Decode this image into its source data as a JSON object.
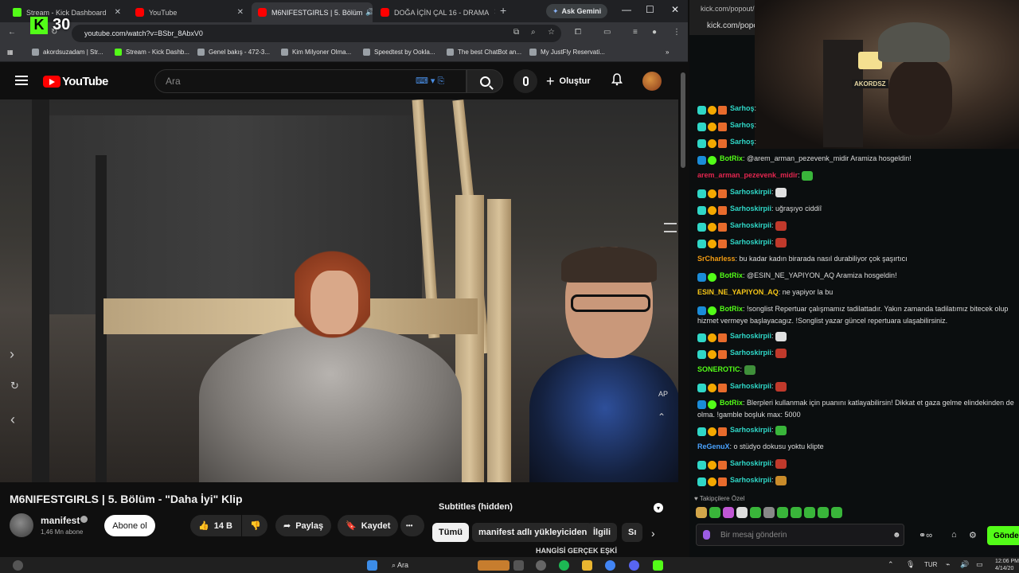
{
  "browser": {
    "tabs": [
      {
        "label": "Stream - Kick Dashboard",
        "favicon": "kick"
      },
      {
        "label": "YouTube",
        "favicon": "youtube"
      },
      {
        "label": "M6NIFESTGIRLS | 5. Bölüm",
        "favicon": "youtube",
        "active": true
      },
      {
        "label": "DOĞA İÇİN ÇAL 16 - DRAMA",
        "favicon": "youtube"
      }
    ],
    "new_tab": "+",
    "gemini_label": "Ask Gemini",
    "window_controls": [
      "—",
      "☐",
      "✕"
    ],
    "url": "youtube.com/watch?v=BSbr_8AbxV0",
    "bookmarks": [
      {
        "label": "akordsuzadam | Str...",
        "favicon": "generic"
      },
      {
        "label": "Stream - Kick Dashb...",
        "favicon": "kick"
      },
      {
        "label": "Genel bakış - 472-3...",
        "favicon": "generic"
      },
      {
        "label": "Kim Milyoner Olma...",
        "favicon": "generic"
      },
      {
        "label": "Speedtest by Ookla...",
        "favicon": "generic"
      },
      {
        "label": "The best ChatBot an...",
        "favicon": "generic"
      },
      {
        "label": "My JustFly Reservati...",
        "favicon": "generic"
      }
    ]
  },
  "kick_overlay": {
    "count": "30"
  },
  "youtube": {
    "logo_text": "YouTube",
    "search_placeholder": "Ara",
    "create_label": "Oluştur",
    "video_overlay_label": "AP",
    "video": {
      "title": "M6NIFESTGIRLS | 5. Bölüm - \"Daha İyi\" Klip",
      "channel": "manifest",
      "subscribers": "1,46 Mn abone",
      "subscribe_label": "Abone ol",
      "likes": "14 B",
      "share_label": "Paylaş",
      "save_label": "Kaydet",
      "more_label": "•••"
    },
    "side": {
      "subtitles_label": "Subtitles (hidden)",
      "chips": [
        "Tümü",
        "manifest adlı yükleyiciden",
        "İlgili",
        "Sı"
      ],
      "next_video_title": "HANGİSİ GERÇEK EŞKİ"
    }
  },
  "chat": {
    "popout_url_top": "kick.com/popout/",
    "popout_url": "kick.com/popo",
    "cam_sign": "AKORDSZ",
    "messages": [
      {
        "user": "Sarhoş",
        "badges": [
          "gift",
          "coin",
          "crown"
        ],
        "user_color": "#2fd7c7",
        "text": ""
      },
      {
        "user": "Sarhoş",
        "badges": [
          "gift",
          "coin",
          "crown"
        ],
        "user_color": "#2fd7c7",
        "text": ""
      },
      {
        "user": "Sarhoş",
        "badges": [
          "gift",
          "coin",
          "crown"
        ],
        "user_color": "#2fd7c7",
        "text": ""
      },
      {
        "user": "BotRix",
        "badges": [
          "bot",
          "verif"
        ],
        "user_color": "#53fc18",
        "text": "@arem_arman_pezevenk_midir Aramiza hosgeldin!"
      },
      {
        "user": "arem_arman_pezevenk_midir",
        "badges": [],
        "user_color": "#e3264f",
        "text": "",
        "emote": "#39b53a"
      },
      {
        "user": "Sarhoskirpii",
        "badges": [
          "gift",
          "coin",
          "crown"
        ],
        "user_color": "#2fd7c7",
        "text": "",
        "emote": "#e0e0e0"
      },
      {
        "user": "Sarhoskirpii",
        "badges": [
          "gift",
          "coin",
          "crown"
        ],
        "user_color": "#2fd7c7",
        "text": "uğraşıyo ciddiî"
      },
      {
        "user": "Sarhoskirpii",
        "badges": [
          "gift",
          "coin",
          "crown"
        ],
        "user_color": "#2fd7c7",
        "text": "",
        "emote": "#c0392b"
      },
      {
        "user": "Sarhoskirpii",
        "badges": [
          "gift",
          "coin",
          "crown"
        ],
        "user_color": "#2fd7c7",
        "text": "",
        "emote": "#c0392b"
      },
      {
        "user": "SrCharless",
        "badges": [],
        "user_color": "#f39c12",
        "text": "bu kadar kadın birarada nasıl durabiliyor çok şaşırtıcı"
      },
      {
        "user": "BotRix",
        "badges": [
          "bot",
          "verif"
        ],
        "user_color": "#53fc18",
        "text": "@ESIN_NE_YAPIYON_AQ Aramiza hosgeldin!"
      },
      {
        "user": "ESIN_NE_YAPIYON_AQ",
        "badges": [],
        "user_color": "#f5c518",
        "text": "ne yapiyor la bu"
      },
      {
        "user": "BotRix",
        "badges": [
          "bot",
          "verif"
        ],
        "user_color": "#53fc18",
        "text": "!songlist Repertuar çalışmamız tadilattadır. Yakın zamanda tadilatımız bitecek olup hizmet vermeye başlayacagız. !Songlist yazar güncel repertuara ulaşabilirsiniz.",
        "lines": 2
      },
      {
        "user": "Sarhoskirpii",
        "badges": [
          "gift",
          "coin",
          "crown"
        ],
        "user_color": "#2fd7c7",
        "text": "",
        "emote": "#e0e0e0"
      },
      {
        "user": "Sarhoskirpii",
        "badges": [
          "gift",
          "coin",
          "crown"
        ],
        "user_color": "#2fd7c7",
        "text": "",
        "emote": "#c0392b"
      },
      {
        "user": "SONEROTIC",
        "badges": [],
        "user_color": "#53fc18",
        "text": "",
        "emote": "#3f8f3a"
      },
      {
        "user": "Sarhoskirpii",
        "badges": [
          "gift",
          "coin",
          "crown"
        ],
        "user_color": "#2fd7c7",
        "text": "",
        "emote": "#c0392b"
      },
      {
        "user": "BotRix",
        "badges": [
          "bot",
          "verif"
        ],
        "user_color": "#53fc18",
        "text": "Blerpleri kullanmak için puanını katlayabilirsin! Dikkat et gaza gelme elindekinden de olma. !gamble boşluk max: 5000",
        "lines": 2
      },
      {
        "user": "Sarhoskirpii",
        "badges": [
          "gift",
          "coin",
          "crown"
        ],
        "user_color": "#2fd7c7",
        "text": "",
        "emote": "#39b53a"
      },
      {
        "user": "ReGenuX",
        "badges": [],
        "user_color": "#4aa3ff",
        "text": "o stüdyo dokusu yoktu klipte"
      },
      {
        "user": "Sarhoskirpii",
        "badges": [
          "gift",
          "coin",
          "crown"
        ],
        "user_color": "#2fd7c7",
        "text": "",
        "emote": "#c0392b"
      },
      {
        "user": "Sarhoskirpii",
        "badges": [
          "gift",
          "coin",
          "crown"
        ],
        "user_color": "#2fd7c7",
        "text": "",
        "emote": "#c98b2a"
      }
    ],
    "followers_label": "Takipçilere Özel",
    "input_placeholder": "Bir mesaj gönderin",
    "send_label": "Gönder"
  },
  "taskbar": {
    "search_label": "Ara",
    "language": "TUR",
    "time": "12:06 PM",
    "date": "4/14/20"
  }
}
